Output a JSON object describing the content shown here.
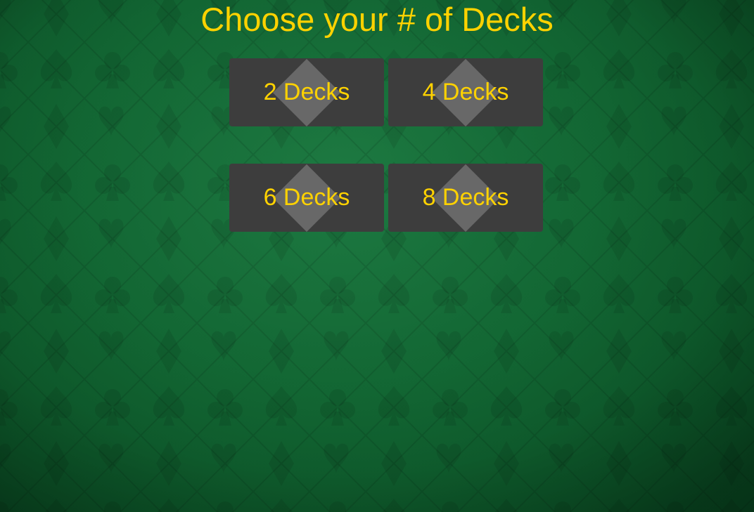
{
  "header": {
    "title": "Choose your # of Decks"
  },
  "deck_options": [
    {
      "label": "2 Decks"
    },
    {
      "label": "4 Decks"
    },
    {
      "label": "6 Decks"
    },
    {
      "label": "8 Decks"
    }
  ],
  "theme": {
    "felt_color": "#136a35",
    "accent": "#ffd200",
    "button_bg": "#3d3d3d",
    "button_diamond": "#686868"
  }
}
